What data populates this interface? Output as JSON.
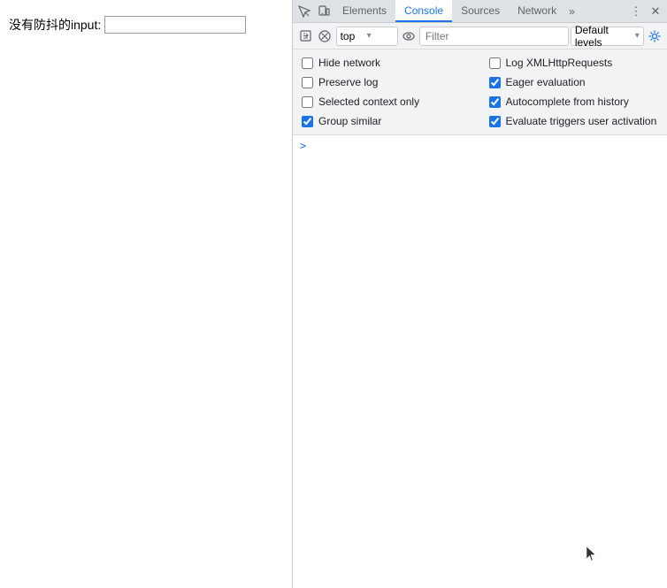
{
  "page": {
    "label": "没有防抖的input:",
    "input_placeholder": ""
  },
  "devtools": {
    "tabs": [
      {
        "id": "elements",
        "label": "Elements",
        "active": false
      },
      {
        "id": "console",
        "label": "Console",
        "active": true
      },
      {
        "id": "sources",
        "label": "Sources",
        "active": false
      },
      {
        "id": "network",
        "label": "Network",
        "active": false
      }
    ],
    "overflow_label": "»",
    "more_label": "⋮",
    "close_label": "✕",
    "toolbar": {
      "context_value": "top",
      "filter_placeholder": "Filter",
      "level_label": "Default levels",
      "execute_icon": "▶",
      "clear_icon": "🚫",
      "eye_icon": "👁"
    },
    "settings": {
      "items_left": [
        {
          "id": "hide-network",
          "label": "Hide network",
          "checked": false
        },
        {
          "id": "preserve-log",
          "label": "Preserve log",
          "checked": false
        },
        {
          "id": "selected-context-only",
          "label": "Selected context only",
          "checked": false
        },
        {
          "id": "group-similar",
          "label": "Group similar",
          "checked": true
        }
      ],
      "items_right": [
        {
          "id": "log-xmlhttp",
          "label": "Log XMLHttpRequests",
          "checked": false
        },
        {
          "id": "eager-eval",
          "label": "Eager evaluation",
          "checked": true
        },
        {
          "id": "autocomplete-history",
          "label": "Autocomplete from history",
          "checked": true
        },
        {
          "id": "evaluate-triggers",
          "label": "Evaluate triggers user activation",
          "checked": true
        }
      ]
    },
    "console_prompt": ">"
  }
}
